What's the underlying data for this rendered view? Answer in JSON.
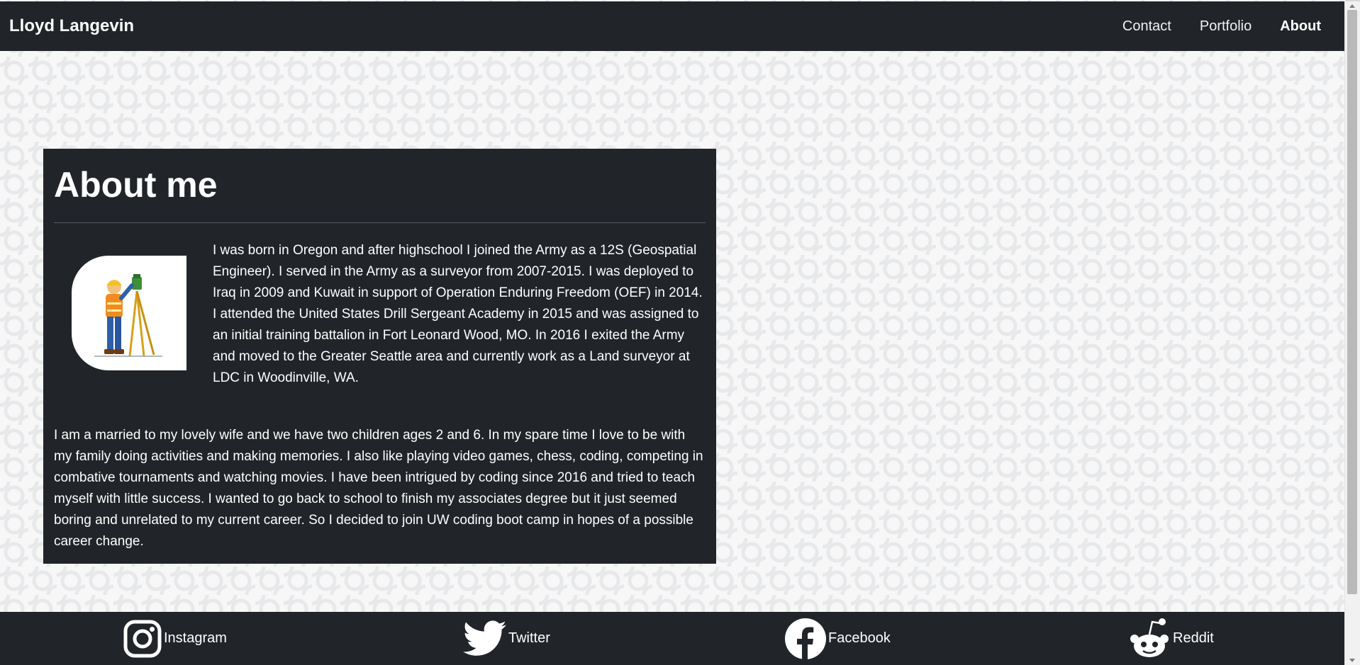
{
  "navbar": {
    "brand": "Lloyd Langevin",
    "links": [
      {
        "label": "Contact"
      },
      {
        "label": "Portfolio"
      },
      {
        "label": "About",
        "active": true
      }
    ]
  },
  "about": {
    "title": "About me",
    "avatar_icon": "surveyor-illustration",
    "paragraph1": "I was born in Oregon and after highschool I joined the Army as a 12S (Geospatial Engineer). I served in the Army as a surveyor from 2007-2015. I was deployed to Iraq in 2009 and Kuwait in support of Operation Enduring Freedom (OEF) in 2014. I attended the United States Drill Sergeant Academy in 2015 and was assigned to an initial training battalion in Fort Leonard Wood, MO. In 2016 I exited the Army and moved to the Greater Seattle area and currently work as a Land surveyor at LDC in Woodinville, WA.",
    "paragraph2": "I am a married to my lovely wife and we have two children ages 2 and 6. In my spare time I love to be with my family doing activities and making memories. I also like playing video games, chess, coding, competing in combative tournaments and watching movies. I have been intrigued by coding since 2016 and tried to teach myself with little success. I wanted to go back to school to finish my associates degree but it just seemed boring and unrelated to my current career. So I decided to join UW coding boot camp in hopes of a possible career change."
  },
  "footer": {
    "links": [
      {
        "label": "Instagram",
        "icon": "instagram-icon"
      },
      {
        "label": "Twitter",
        "icon": "twitter-icon"
      },
      {
        "label": "Facebook",
        "icon": "facebook-icon"
      },
      {
        "label": "Reddit",
        "icon": "reddit-icon"
      }
    ]
  },
  "colors": {
    "dark": "#212529",
    "text": "#ffffff",
    "pattern": "#e7e8ea"
  }
}
